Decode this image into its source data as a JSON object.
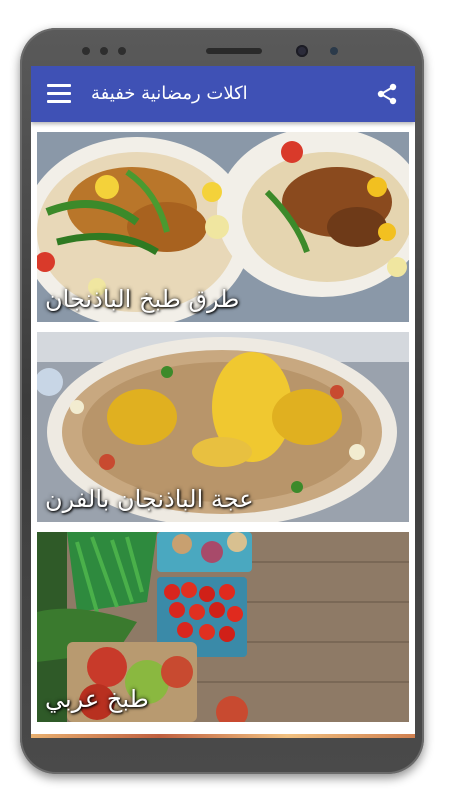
{
  "app": {
    "title": "اكلات رمضانية خفيفة",
    "bar_color": "#3f51b5"
  },
  "icons": {
    "menu": "hamburger-menu-icon",
    "share": "share-icon"
  },
  "recipes": [
    {
      "label": "طرق طبخ الباذنجان"
    },
    {
      "label": "عجة الباذنجان بالفرن"
    },
    {
      "label": "طبخ عربي"
    }
  ]
}
